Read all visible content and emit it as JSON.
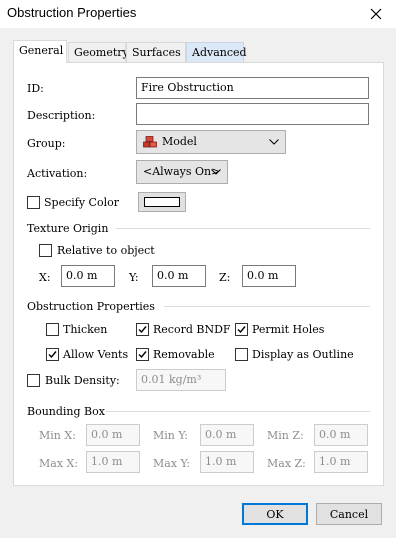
{
  "window": {
    "title": "Obstruction Properties",
    "close_icon": "close-icon"
  },
  "tabs": [
    {
      "label": "General",
      "active": true
    },
    {
      "label": "Geometry"
    },
    {
      "label": "Surfaces"
    },
    {
      "label": "Advanced"
    }
  ],
  "general": {
    "id_label": "ID:",
    "id_value": "Fire Obstruction",
    "description_label": "Description:",
    "description_value": "",
    "group_label": "Group:",
    "group_value": "Model",
    "group_icon": "bricks-icon",
    "activation_label": "Activation:",
    "activation_value": "<Always On>",
    "specify_color_label": "Specify Color",
    "specify_color_checked": false,
    "swatch_color": "#ffffff"
  },
  "texture_origin": {
    "heading": "Texture Origin",
    "relative_label": "Relative to object",
    "relative_checked": false,
    "x_label": "X:",
    "x_value": "0.0 m",
    "y_label": "Y:",
    "y_value": "0.0 m",
    "z_label": "Z:",
    "z_value": "0.0 m"
  },
  "obstruction_properties": {
    "heading": "Obstruction Properties",
    "thicken_label": "Thicken",
    "thicken_checked": false,
    "record_bndf_label": "Record BNDF",
    "record_bndf_checked": true,
    "permit_holes_label": "Permit Holes",
    "permit_holes_checked": true,
    "allow_vents_label": "Allow Vents",
    "allow_vents_checked": true,
    "removable_label": "Removable",
    "removable_checked": true,
    "display_outline_label": "Display as Outline",
    "display_outline_checked": false,
    "bulk_density_label": "Bulk Density:",
    "bulk_density_checked": false,
    "bulk_density_value": "0.01 kg/m³"
  },
  "bounding_box": {
    "heading": "Bounding Box",
    "min_x_label": "Min X:",
    "min_x": "0.0 m",
    "min_y_label": "Min Y:",
    "min_y": "0.0 m",
    "min_z_label": "Min Z:",
    "min_z": "0.0 m",
    "max_x_label": "Max X:",
    "max_x": "1.0 m",
    "max_y_label": "Max Y:",
    "max_y": "1.0 m",
    "max_z_label": "Max Z:",
    "max_z": "1.0 m"
  },
  "buttons": {
    "ok": "OK",
    "cancel": "Cancel"
  },
  "colors": {
    "accent": "#0078d7",
    "advanced_tab": "#dbe8f7",
    "brick": "#c0392b"
  }
}
